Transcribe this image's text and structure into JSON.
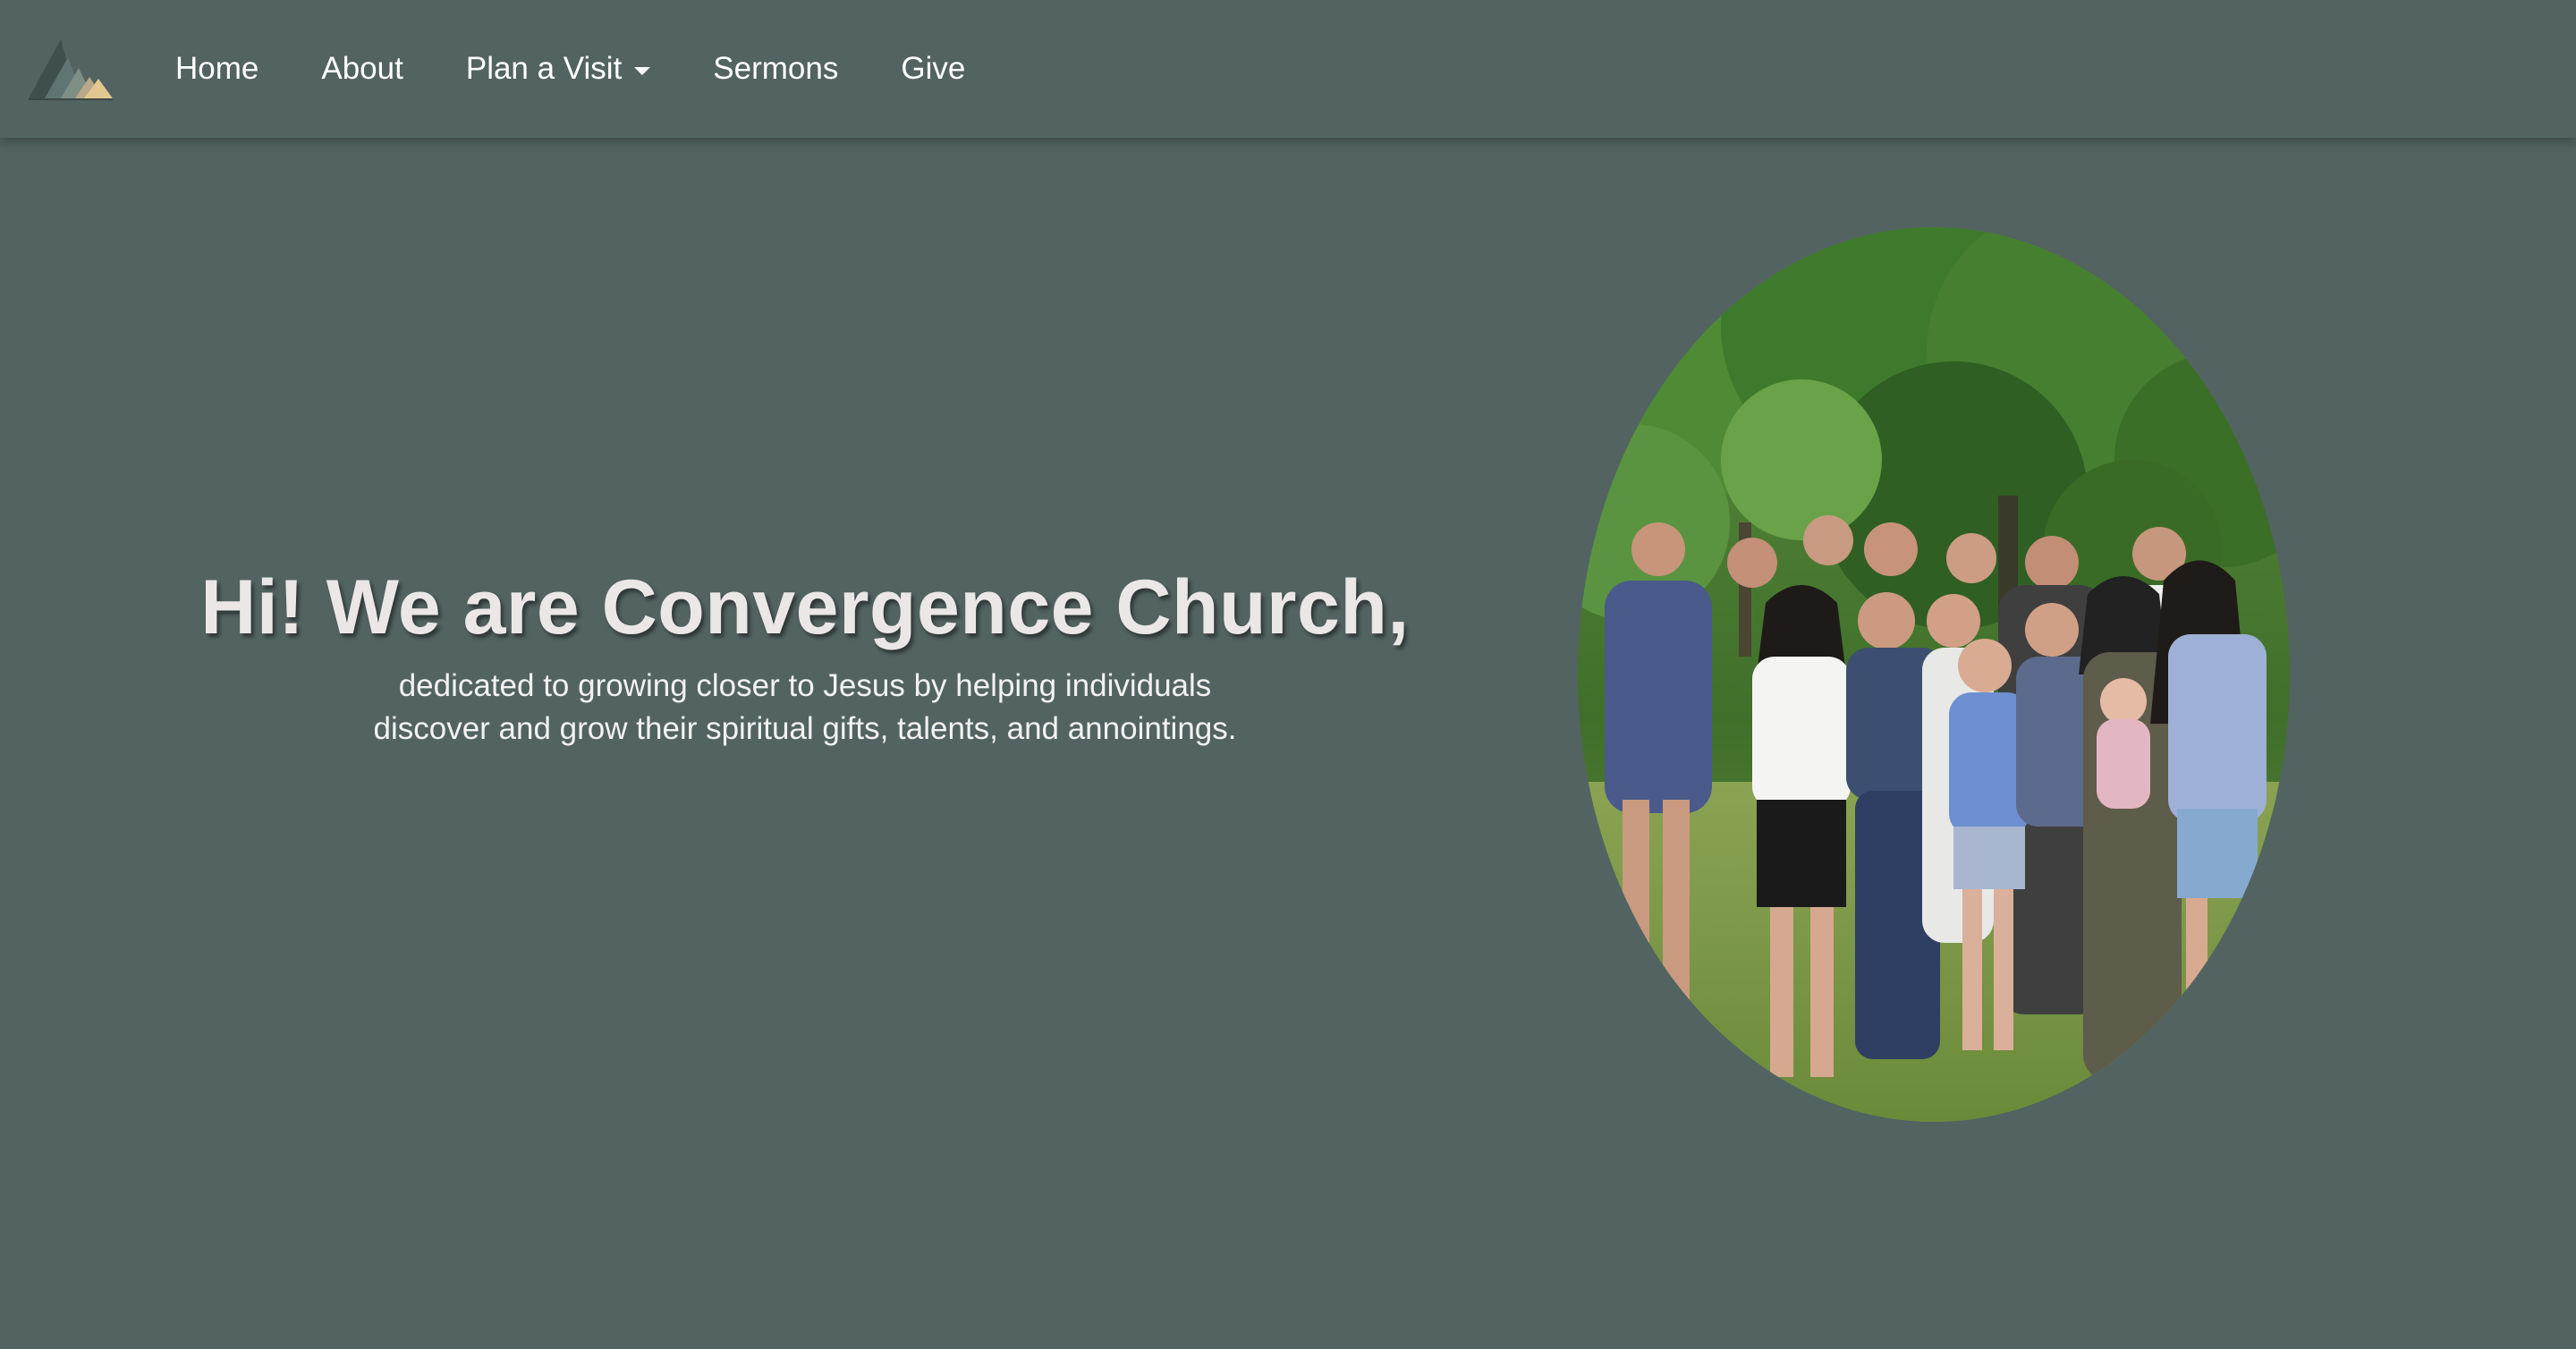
{
  "nav": {
    "logo_alt": "Convergence Church logo",
    "items": [
      {
        "label": "Home"
      },
      {
        "label": "About"
      },
      {
        "label": "Plan a Visit",
        "has_dropdown": true
      },
      {
        "label": "Sermons"
      },
      {
        "label": "Give"
      }
    ]
  },
  "hero": {
    "title": "Hi! We are Convergence Church,",
    "subtitle_line1": "dedicated to growing closer to Jesus by helping individuals",
    "subtitle_line2": "discover and grow their spiritual gifts, talents, and annointings.",
    "image_alt": "Group photo of church members outdoors"
  },
  "colors": {
    "background": "#526361",
    "text": "#ffffff",
    "title": "#ece7e7"
  }
}
